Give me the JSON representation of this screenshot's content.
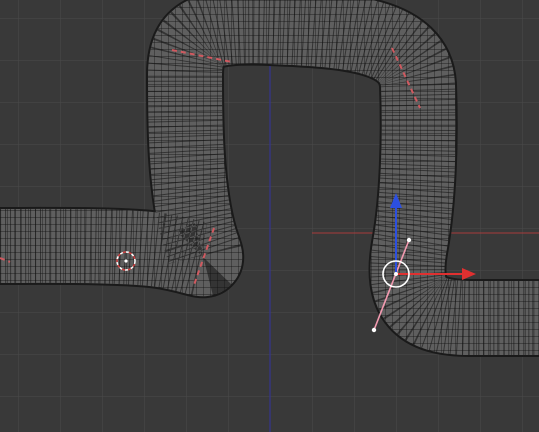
{
  "viewport": {
    "background": "#393939",
    "grid_color": "#4a4a4a",
    "x_axis_color": "#a83c3c",
    "y_axis_color": "#35358f"
  },
  "tube": {
    "mode": "wireframe",
    "wire_color": "#0d0d0d",
    "seam_color": "#d05a60"
  },
  "gizmo": {
    "x_arrow_color": "#e03030",
    "z_arrow_color": "#2c4fe0",
    "handle_color": "#ffffff",
    "tangent_line_color": "#f39ab0"
  },
  "cursor_3d": {
    "ring_outer": "#ffffff",
    "ring_inner": "#d04040"
  },
  "icons": [
    "3d-cursor-icon",
    "transform-gizmo-icon",
    "x-arrow-icon",
    "z-arrow-icon"
  ]
}
